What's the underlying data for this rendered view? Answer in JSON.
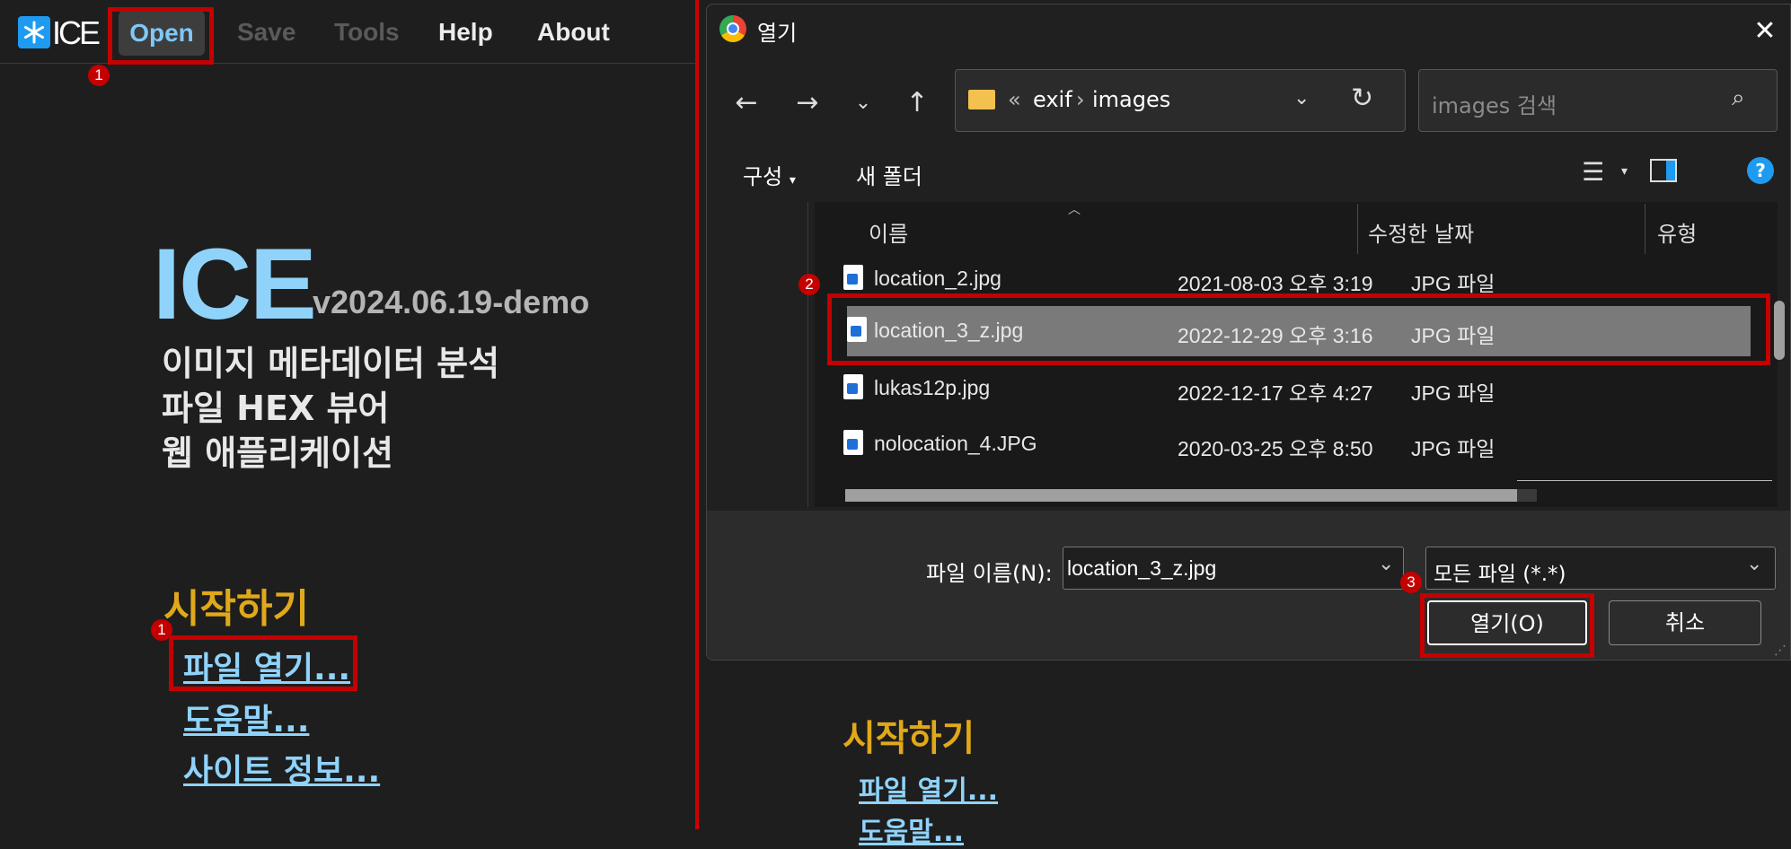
{
  "app": {
    "logo_text": "ICE",
    "menu": {
      "open": "Open",
      "save": "Save",
      "tools": "Tools",
      "help": "Help",
      "about": "About"
    },
    "hero": {
      "title": "ICE",
      "version": "v2024.06.19-demo",
      "lines": [
        "이미지 메타데이터 분석",
        "파일 HEX 뷰어",
        "웹 애플리케이션"
      ]
    },
    "start": {
      "title": "시작하기",
      "links": [
        "파일 열기...",
        "도움말...",
        "사이트 정보..."
      ]
    },
    "step_badges": [
      "1",
      "1",
      "2",
      "3"
    ]
  },
  "dialog": {
    "title": "열기",
    "address": {
      "overflow": "«",
      "crumbs": [
        "exif",
        "images"
      ]
    },
    "search_placeholder": "images 검색",
    "toolbar": {
      "organize": "구성",
      "new_folder": "새 폴더"
    },
    "columns": [
      "이름",
      "수정한 날짜",
      "유형"
    ],
    "files": [
      {
        "name": "location_2.jpg",
        "date": "2021-08-03 오후 3:19",
        "type": "JPG 파일",
        "selected": false
      },
      {
        "name": "location_3_z.jpg",
        "date": "2022-12-29 오후 3:16",
        "type": "JPG 파일",
        "selected": true
      },
      {
        "name": "lukas12p.jpg",
        "date": "2022-12-17 오후 4:27",
        "type": "JPG 파일",
        "selected": false
      },
      {
        "name": "nolocation_4.JPG",
        "date": "2020-03-25 오후 8:50",
        "type": "JPG 파일",
        "selected": false
      }
    ],
    "filename_label": "파일 이름(N):",
    "filename_value": "location_3_z.jpg",
    "filetype_value": "모든 파일 (*.*)",
    "open_button": "열기(O)",
    "cancel_button": "취소"
  },
  "background": {
    "start_title": "시작하기",
    "links": [
      "파일 열기...",
      "도움말..."
    ]
  },
  "colors": {
    "accent_blue": "#8fd3fb",
    "section_gold": "#e0a81a",
    "highlight_red": "#c40000"
  }
}
